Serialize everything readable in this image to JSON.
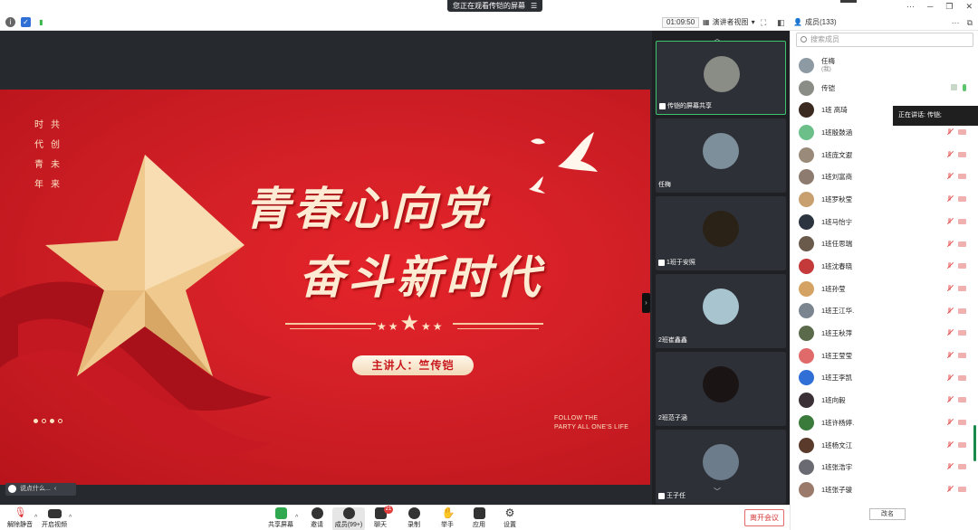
{
  "titlebar": {
    "screen_notice": "您正在观看传铠的屏幕",
    "controls": [
      "···",
      "─",
      "❐",
      "✕"
    ]
  },
  "toolbar": {
    "timer": "01:09:50",
    "view_mode": "演讲者视图",
    "members_title": "成员(133)"
  },
  "slide": {
    "poem": [
      "时",
      "共",
      "代",
      "创",
      "青",
      "未",
      "年",
      "来"
    ],
    "title_line1": "青春心向党",
    "title_line2": "奋斗新时代",
    "speaker": "主讲人：竺传铠",
    "follow_line1": "FOLLOW THE",
    "follow_line2": "PARTY ALL ONE'S LIFE",
    "dots_active": [
      true,
      false,
      true,
      false
    ]
  },
  "stage": {
    "chat_placeholder": "说点什么...",
    "collapse_icon": "chevron-left-icon"
  },
  "thumbnails": [
    {
      "name": "传铠的屏幕共享",
      "color": "#8a8c86",
      "active": true
    },
    {
      "name": "任梅",
      "color": "#7e8f9c",
      "active": false
    },
    {
      "name": "1班于安照",
      "color": "#2a2216",
      "active": false
    },
    {
      "name": "2班崔鑫鑫",
      "color": "#a8c5cf",
      "active": false
    },
    {
      "name": "2班范子涵",
      "color": "#1b1414",
      "active": false
    },
    {
      "name": "王子任",
      "color": "#6c7c8a",
      "active": false
    }
  ],
  "members": {
    "search_placeholder": "搜索成员",
    "speaking_label": "正在讲话: 传铠;",
    "list": [
      {
        "name": "任梅",
        "sub": "(我)",
        "color": "#8e9aa3",
        "mic": "none"
      },
      {
        "name": "传铠",
        "sub": "",
        "color": "#8a8c86",
        "mic": "on"
      },
      {
        "name": "1班 高琦",
        "sub": "",
        "color": "#3a2a20",
        "mic": "off"
      },
      {
        "name": "1班殷鼓涵",
        "sub": "",
        "color": "#6dbf8a",
        "mic": "off"
      },
      {
        "name": "1班庞文遐",
        "sub": "",
        "color": "#9a8a7a",
        "mic": "off"
      },
      {
        "name": "1班刘富商",
        "sub": "",
        "color": "#8c7b6e",
        "mic": "off"
      },
      {
        "name": "1班罗秋莹",
        "sub": "",
        "color": "#c8a070",
        "mic": "off"
      },
      {
        "name": "1班马怡宁",
        "sub": "",
        "color": "#2c3440",
        "mic": "off"
      },
      {
        "name": "1班任思瑞",
        "sub": "",
        "color": "#6a5a4c",
        "mic": "off"
      },
      {
        "name": "1班沈春晓",
        "sub": "",
        "color": "#c43a3a",
        "mic": "off"
      },
      {
        "name": "1班孙莹",
        "sub": "",
        "color": "#d4a262",
        "mic": "off"
      },
      {
        "name": "1班王江华.",
        "sub": "",
        "color": "#7a8590",
        "mic": "off"
      },
      {
        "name": "1班王秋萍",
        "sub": "",
        "color": "#5a6a4a",
        "mic": "off"
      },
      {
        "name": "1班王莹莹",
        "sub": "",
        "color": "#e06a6a",
        "mic": "off"
      },
      {
        "name": "1班王李凯",
        "sub": "",
        "color": "#2f6fd6",
        "mic": "off"
      },
      {
        "name": "1班向毅",
        "sub": "",
        "color": "#3a3036",
        "mic": "off"
      },
      {
        "name": "1班许杨婷.",
        "sub": "",
        "color": "#3a7a3a",
        "mic": "off"
      },
      {
        "name": "1班杨文江",
        "sub": "",
        "color": "#5a3a2a",
        "mic": "off"
      },
      {
        "name": "1班张浩宇",
        "sub": "",
        "color": "#6a6a72",
        "mic": "off"
      },
      {
        "name": "1班张子骏",
        "sub": "",
        "color": "#9a7a6a",
        "mic": "off"
      }
    ],
    "rename_button": "改名"
  },
  "bottombar": {
    "mute": "解除静音",
    "video": "开启视频",
    "share": "共享屏幕",
    "invite": "邀请",
    "members": "成员(99+)",
    "chat": "聊天",
    "chat_badge": "21",
    "record": "录制",
    "raise_hand": "举手",
    "apps": "应用",
    "settings": "设置",
    "leave": "离开会议"
  }
}
